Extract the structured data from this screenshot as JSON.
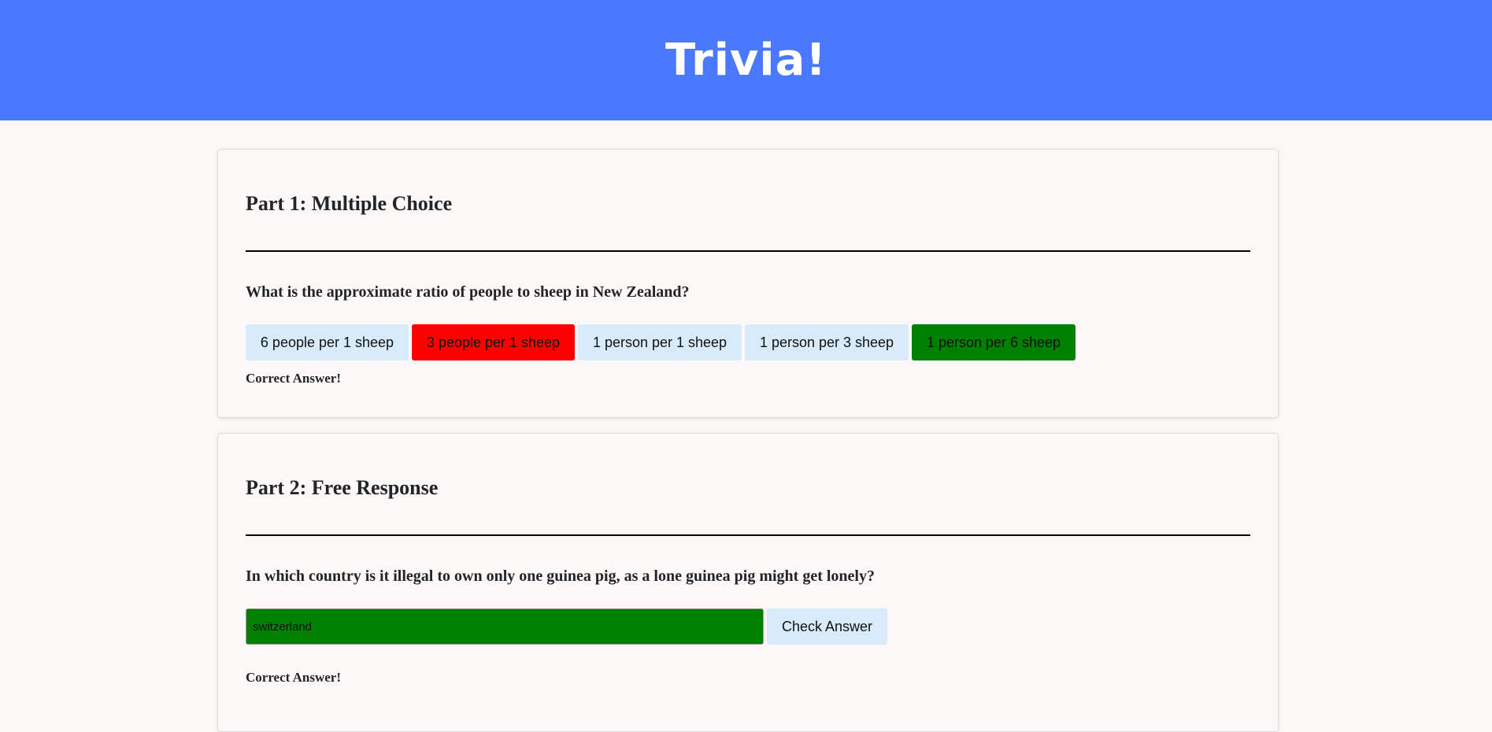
{
  "header": {
    "title": "Trivia!"
  },
  "part1": {
    "heading": "Part 1: Multiple Choice",
    "question": "What is the approximate ratio of people to sheep in New Zealand?",
    "choices": [
      "6 people per 1 sheep",
      "3 people per 1 sheep",
      "1 person per 1 sheep",
      "1 person per 3 sheep",
      "1 person per 6 sheep"
    ],
    "feedback": "Correct Answer!",
    "colors": {
      "default": "#d8ebfb",
      "incorrect": "#ff0000",
      "correct": "#008000"
    }
  },
  "part2": {
    "heading": "Part 2: Free Response",
    "question": "In which country is it illegal to own only one guinea pig, as a lone guinea pig might get lonely?",
    "input_value": "switzerland",
    "check_button_label": "Check Answer",
    "feedback": "Correct Answer!"
  },
  "colors": {
    "header_bg": "#4a79ff",
    "page_bg": "#fdf8f8"
  }
}
